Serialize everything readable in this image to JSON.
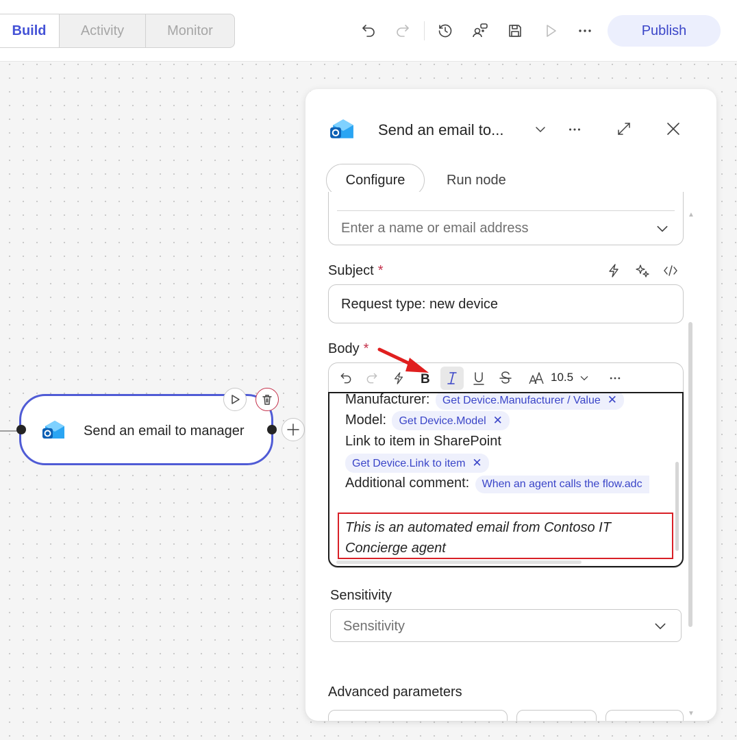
{
  "topbar": {
    "tabs": [
      "Build",
      "Activity",
      "Monitor"
    ],
    "publish_label": "Publish",
    "icons": [
      "undo-icon",
      "redo-icon",
      "history-icon",
      "connections-icon",
      "save-icon",
      "play-icon",
      "more-icon"
    ]
  },
  "canvas": {
    "node_title": "Send an email to manager"
  },
  "panel": {
    "title": "Send an email to...",
    "tabs": {
      "configure": "Configure",
      "run_node": "Run node"
    },
    "to_placeholder": "Enter a name or email address",
    "subject": {
      "label": "Subject",
      "required_mark": "*",
      "value": "Request type: new device"
    },
    "body": {
      "label": "Body",
      "required_mark": "*",
      "font_size": "10.5",
      "lines": {
        "manufacturer_label": "Manufacturer:",
        "manufacturer_token": "Get Device.Manufacturer / Value",
        "model_label": "Model:",
        "model_token": "Get Device.Model",
        "link_label": "Link to item in SharePoint",
        "link_token": "Get Device.Link to item",
        "comment_label": "Additional comment:",
        "comment_token": "When an agent calls the flow.adc",
        "footer_line1": "This is an automated email from Contoso IT",
        "footer_line2": "Concierge agent"
      },
      "token_remove": "✕"
    },
    "sensitivity": {
      "label": "Sensitivity",
      "placeholder": "Sensitivity"
    },
    "advanced_label": "Advanced parameters"
  },
  "colors": {
    "accent": "#4452d6",
    "node_border": "#4f5bd5",
    "chip_bg": "#eef0fc",
    "required": "#c4314b",
    "annotation_red": "#e01f1f"
  }
}
